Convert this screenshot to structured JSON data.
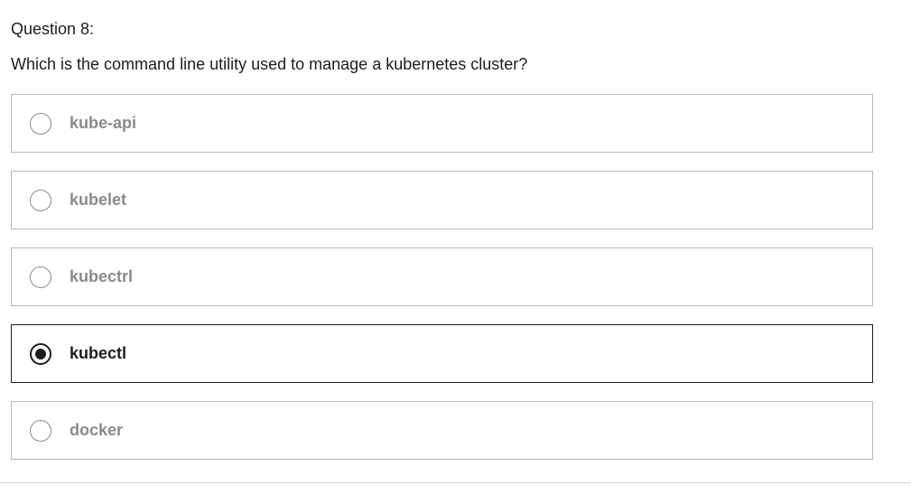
{
  "question": {
    "number_label": "Question 8:",
    "text": "Which is the command line utility used to manage a kubernetes cluster?"
  },
  "options": [
    {
      "label": "kube-api",
      "selected": false
    },
    {
      "label": "kubelet",
      "selected": false
    },
    {
      "label": "kubectrl",
      "selected": false
    },
    {
      "label": "kubectl",
      "selected": true
    },
    {
      "label": "docker",
      "selected": false
    }
  ],
  "colors": {
    "text": "#1c1d1f",
    "muted": "#8a8a8a",
    "border": "#b8b8b8"
  }
}
